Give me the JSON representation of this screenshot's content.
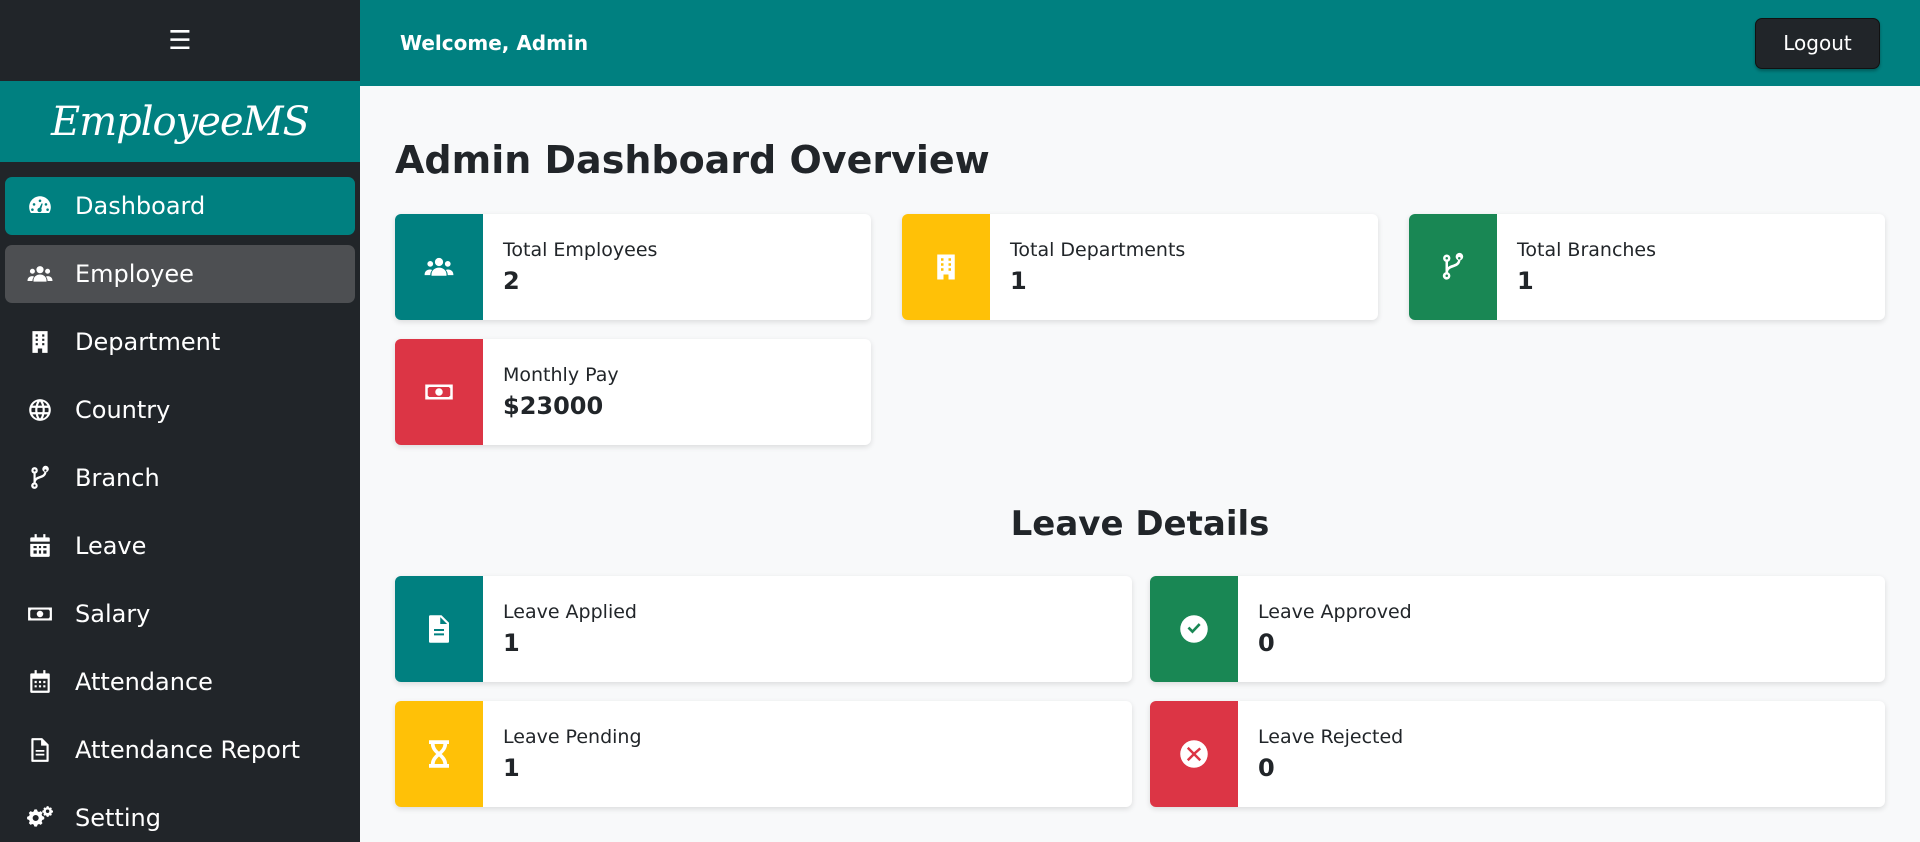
{
  "sidebar": {
    "toggle_icon": "☰",
    "brand": "EmployeeMS",
    "items": [
      {
        "label": "Dashboard",
        "icon": "gauge-icon"
      },
      {
        "label": "Employee",
        "icon": "users-icon"
      },
      {
        "label": "Department",
        "icon": "building-icon"
      },
      {
        "label": "Country",
        "icon": "globe-icon"
      },
      {
        "label": "Branch",
        "icon": "code-branch-icon"
      },
      {
        "label": "Leave",
        "icon": "calendar-icon"
      },
      {
        "label": "Salary",
        "icon": "money-icon"
      },
      {
        "label": "Attendance",
        "icon": "calendar-check-icon"
      },
      {
        "label": "Attendance Report",
        "icon": "file-icon"
      },
      {
        "label": "Setting",
        "icon": "gears-icon"
      }
    ]
  },
  "topbar": {
    "welcome": "Welcome, Admin",
    "logout_label": "Logout"
  },
  "main": {
    "title": "Admin Dashboard Overview",
    "stats": [
      {
        "label": "Total Employees",
        "value": "2",
        "icon": "users-icon",
        "color": "#008080"
      },
      {
        "label": "Total Departments",
        "value": "1",
        "icon": "building-icon",
        "color": "#ffc107"
      },
      {
        "label": "Total Branches",
        "value": "1",
        "icon": "code-branch-icon",
        "color": "#198754"
      },
      {
        "label": "Monthly Pay",
        "value": "$23000",
        "icon": "money-icon",
        "color": "#dc3545"
      }
    ],
    "leave_title": "Leave Details",
    "leave": [
      {
        "label": "Leave Applied",
        "value": "1",
        "icon": "file-icon",
        "color": "#008080"
      },
      {
        "label": "Leave Approved",
        "value": "0",
        "icon": "check-circle-icon",
        "color": "#198754"
      },
      {
        "label": "Leave Pending",
        "value": "1",
        "icon": "hourglass-icon",
        "color": "#ffc107"
      },
      {
        "label": "Leave Rejected",
        "value": "0",
        "icon": "times-circle-icon",
        "color": "#dc3545"
      }
    ]
  },
  "colors": {
    "accent": "#008080",
    "sidebar_bg": "#212529",
    "background": "#f8f9fa"
  }
}
